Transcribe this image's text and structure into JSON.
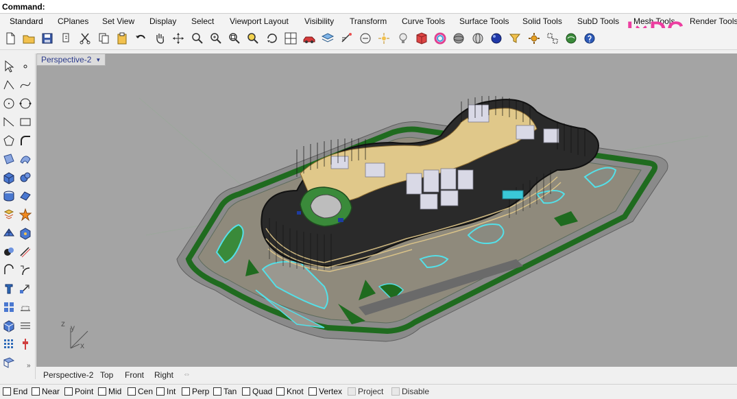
{
  "command": {
    "label": "Command:"
  },
  "menu_tabs": [
    "Standard",
    "CPlanes",
    "Set View",
    "Display",
    "Select",
    "Viewport Layout",
    "Visibility",
    "Transform",
    "Curve Tools",
    "Surface Tools",
    "Solid Tools",
    "SubD Tools",
    "Mesh Tools",
    "Render Tools"
  ],
  "toolbar_icons": [
    "new-icon",
    "open-icon",
    "save-icon",
    "print-icon",
    "cut-icon",
    "copy-icon",
    "paste-icon",
    "undo-icon",
    "pan-icon",
    "rotate-view-icon",
    "zoom-icon",
    "zoom-window-icon",
    "zoom-extents-icon",
    "zoom-selected-icon",
    "rotate-camera-icon",
    "four-viewports-icon",
    "car-icon",
    "layers-icon",
    "properties-icon",
    "grid-snap-icon",
    "light-icon",
    "hide-icon",
    "render-color-icon",
    "sphere-render-icon",
    "wireframe-sphere-icon",
    "shaded-sphere-icon",
    "point-edit-icon",
    "filter-icon",
    "control-points-icon",
    "extract-icon",
    "help-icon"
  ],
  "logo": {
    "text": "IXDC",
    "color": "#ec3ea0"
  },
  "left_icons": [
    "select-icon",
    "point-icon",
    "polyline-icon",
    "curve-icon",
    "circle-icon",
    "circle-3pt-icon",
    "arc-icon",
    "rectangle-icon",
    "polygon-icon",
    "fillet-icon",
    "surface-icon",
    "sweep-icon",
    "box-icon",
    "sphere-icon",
    "cylinder-icon",
    "extrude-icon",
    "boolean-icon",
    "explode-icon",
    "mesh-icon",
    "solid-edit-icon",
    "fillet-curve-icon",
    "offset-icon",
    "text-icon",
    "dimension-icon",
    "array-icon",
    "move-icon",
    "render-icon",
    "lighting-icon",
    "grid-array-icon",
    "history-icon",
    "analyze-icon"
  ],
  "viewport": {
    "title": "Perspective-2",
    "axis_labels": {
      "z": "z",
      "y": "y",
      "x": "x"
    }
  },
  "view_tabs": [
    "Perspective-2",
    "Top",
    "Front",
    "Right"
  ],
  "view_tab_add": "⇔",
  "osnaps": [
    {
      "label": "End",
      "checked": false
    },
    {
      "label": "Near",
      "checked": false
    },
    {
      "label": "Point",
      "checked": false
    },
    {
      "label": "Mid",
      "checked": false
    },
    {
      "label": "Cen",
      "checked": false
    },
    {
      "label": "Int",
      "checked": false
    },
    {
      "label": "Perp",
      "checked": false
    },
    {
      "label": "Tan",
      "checked": false
    },
    {
      "label": "Quad",
      "checked": false
    },
    {
      "label": "Knot",
      "checked": false
    },
    {
      "label": "Vertex",
      "checked": false
    },
    {
      "label": "Project",
      "checked": false,
      "disabled": true
    },
    {
      "label": "Disable",
      "checked": false,
      "disabled": true
    }
  ],
  "colors": {
    "viewport_bg": "#a4a4a4",
    "site_base": "#8d8d8d",
    "grass": "#1f6b1f",
    "cyan": "#54e0e8",
    "facade": "#1b1b1b",
    "floor": "#e0c88a",
    "interior": "#d9d9e6",
    "accent_blue": "#2b3a8c"
  }
}
